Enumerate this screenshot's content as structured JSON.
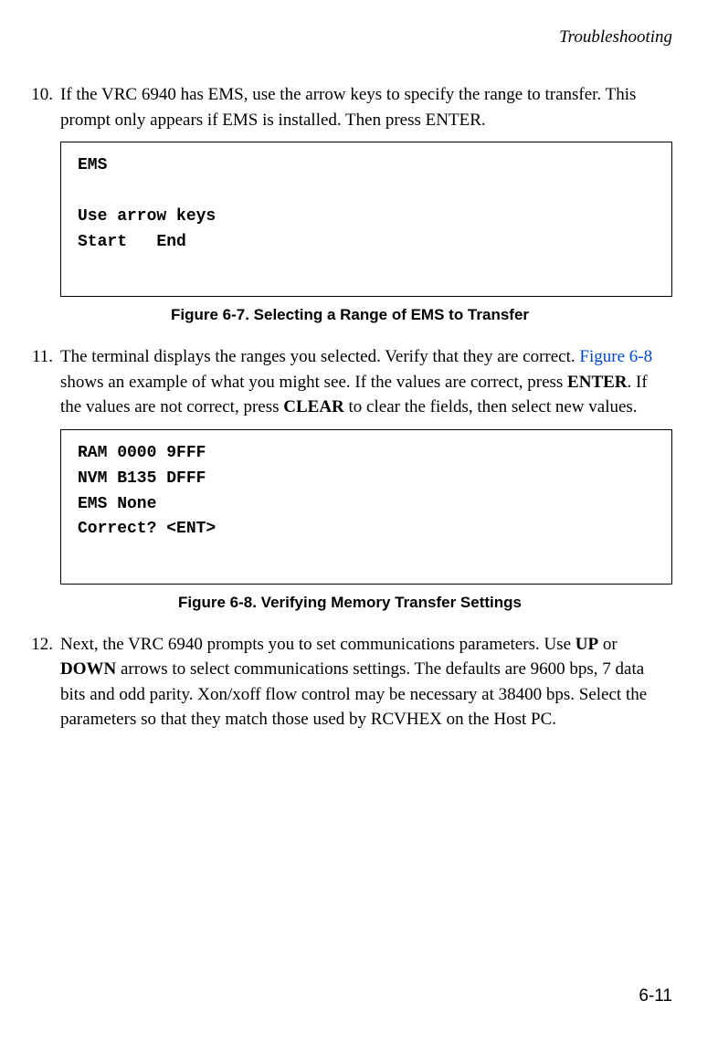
{
  "header": "Troubleshooting",
  "item10": {
    "num": "10.",
    "text": "If the VRC 6940 has EMS, use the arrow keys to specify the range to transfer. This prompt only appears if EMS is installed. Then press ENTER."
  },
  "box1": "EMS\n\nUse arrow keys\nStart   End",
  "caption1": "Figure 6-7.  Selecting a Range of EMS to Transfer",
  "item11": {
    "num": "11.",
    "pre": "The terminal displays the ranges you selected. Verify that they are correct. ",
    "link": "Figure 6-8",
    "mid1": " shows an example of what you might see. If the values are correct, press ",
    "enter": "ENTER",
    "mid2": ". If the values are not correct, press ",
    "clear": "CLEAR",
    "post": " to clear the fields, then select new values."
  },
  "box2": "RAM 0000 9FFF\nNVM B135 DFFF\nEMS None\nCorrect? <ENT>",
  "caption2": "Figure 6-8.  Verifying Memory Transfer Settings",
  "item12": {
    "num": "12.",
    "pre": "Next, the VRC 6940 prompts you to set communications parameters. Use ",
    "up": "UP",
    "mid1": " or ",
    "down": "DOWN",
    "post": " arrows to select communications settings. The defaults are 9600 bps, 7 data bits and odd parity. Xon/xoff flow control may be necessary at 38400 bps. Select the parameters so that they match those used by RCVHEX on the Host PC."
  },
  "pagenum": "6-11"
}
